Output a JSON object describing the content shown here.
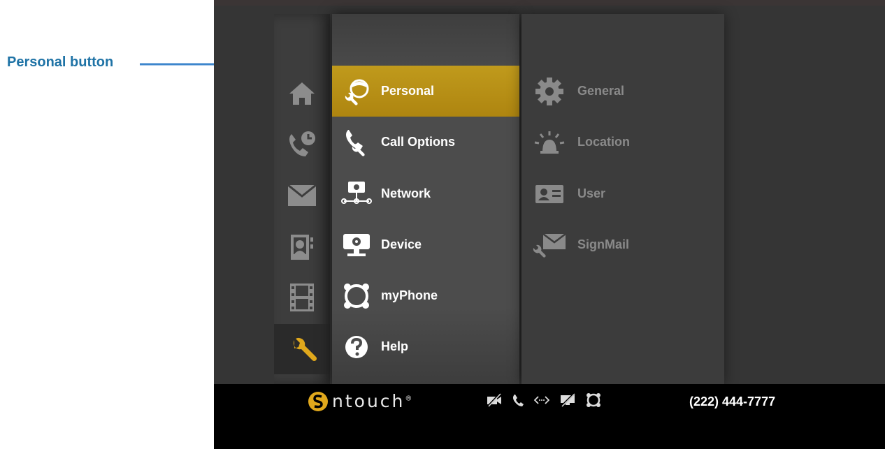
{
  "callout": {
    "text": "Personal button",
    "color": "#1f73a6"
  },
  "rail": {
    "items": [
      {
        "icon": "home-icon",
        "active": false
      },
      {
        "icon": "call-history-icon",
        "active": false
      },
      {
        "icon": "signmail-envelope-icon",
        "active": false
      },
      {
        "icon": "contacts-book-icon",
        "active": false
      },
      {
        "icon": "video-film-icon",
        "active": false
      },
      {
        "icon": "wrench-settings-icon",
        "active": true
      }
    ]
  },
  "menu": {
    "items": [
      {
        "label": "Personal",
        "icon": "personal-icon",
        "selected": true
      },
      {
        "label": "Call Options",
        "icon": "call-options-icon",
        "selected": false
      },
      {
        "label": "Network",
        "icon": "network-icon",
        "selected": false
      },
      {
        "label": "Device",
        "icon": "device-icon",
        "selected": false
      },
      {
        "label": "myPhone",
        "icon": "myphone-icon",
        "selected": false
      },
      {
        "label": "Help",
        "icon": "help-icon",
        "selected": false
      }
    ]
  },
  "submenu": {
    "items": [
      {
        "label": "General",
        "icon": "gear-icon"
      },
      {
        "label": "Location",
        "icon": "location-alarm-icon"
      },
      {
        "label": "User",
        "icon": "user-card-icon"
      },
      {
        "label": "SignMail",
        "icon": "signmail-settings-icon"
      }
    ]
  },
  "status_bar": {
    "brand": "ntouch",
    "brand_mark": "®",
    "icons": [
      "video-off-icon",
      "phone-icon",
      "network-arrows-icon",
      "monitor-off-icon",
      "myphone-status-icon"
    ],
    "phone_number": "(222) 444-7777"
  },
  "colors": {
    "accent_gold": "#c09a1c",
    "rail_icon": "#8c8c8c",
    "wrench_active": "#e0a81c",
    "callout_blue": "#1f73a6",
    "arrow_blue": "#3d86cc"
  }
}
